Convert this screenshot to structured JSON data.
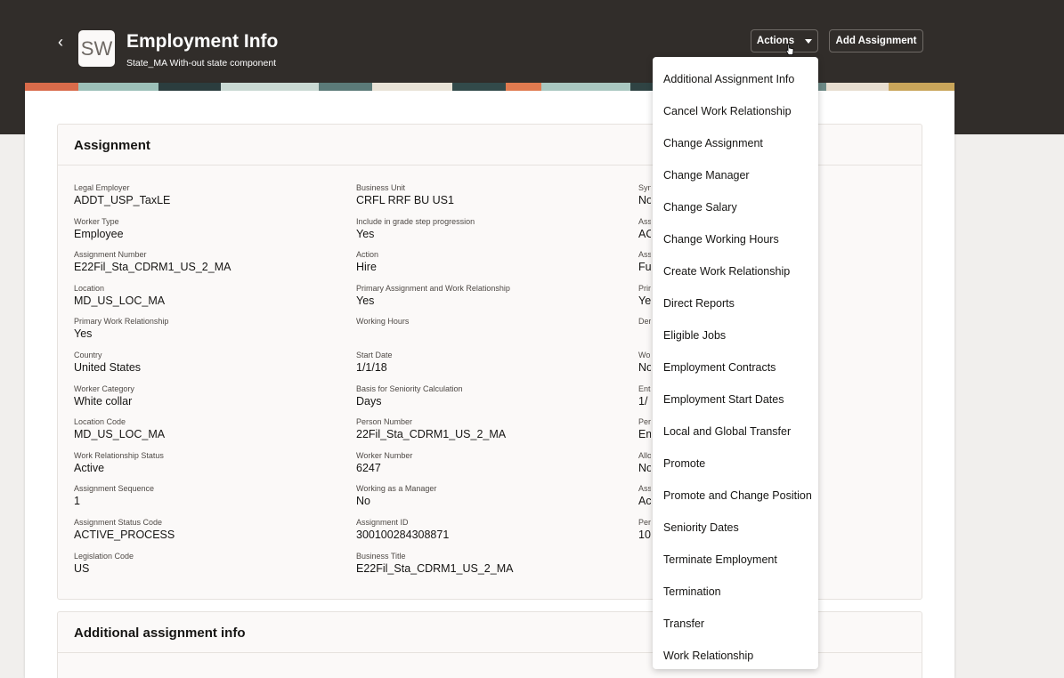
{
  "header": {
    "back_glyph": "‹",
    "avatar_initials": "SW",
    "title": "Employment Info",
    "subtitle": "State_MA With-out state component",
    "actions_label": "Actions",
    "add_assignment_label": "Add Assignment"
  },
  "colors": {
    "header_bg": "#312d2a",
    "page_bg": "#f1efed",
    "card_bg": "#fbf9f8",
    "text": "#161513",
    "label_text": "#4f4a46"
  },
  "assignment": {
    "title": "Assignment",
    "col1": [
      {
        "label": "Legal Employer",
        "value": "ADDT_USP_TaxLE"
      },
      {
        "label": "Worker Type",
        "value": "Employee"
      },
      {
        "label": "Assignment Number",
        "value": "E22Fil_Sta_CDRM1_US_2_MA"
      },
      {
        "label": "Location",
        "value": "MD_US_LOC_MA"
      },
      {
        "label": "Primary Work Relationship",
        "value": "Yes"
      },
      {
        "label": "Country",
        "value": "United States"
      },
      {
        "label": "Worker Category",
        "value": "White collar"
      },
      {
        "label": "Location Code",
        "value": "MD_US_LOC_MA"
      },
      {
        "label": "Work Relationship Status",
        "value": "Active"
      },
      {
        "label": "Assignment Sequence",
        "value": "1"
      },
      {
        "label": "Assignment Status Code",
        "value": "ACTIVE_PROCESS"
      },
      {
        "label": "Legislation Code",
        "value": "US"
      }
    ],
    "col2": [
      {
        "label": "Business Unit",
        "value": "CRFL RRF BU US1"
      },
      {
        "label": "Include in grade step progression",
        "value": "Yes"
      },
      {
        "label": "Action",
        "value": "Hire"
      },
      {
        "label": "Primary Assignment and Work Relationship",
        "value": "Yes"
      },
      {
        "label": "Working Hours",
        "value": ""
      },
      {
        "label": "Start Date",
        "value": "1/1/18"
      },
      {
        "label": "Basis for Seniority Calculation",
        "value": "Days"
      },
      {
        "label": "Person Number",
        "value": "22Fil_Sta_CDRM1_US_2_MA"
      },
      {
        "label": "Worker Number",
        "value": "6247"
      },
      {
        "label": "Working as a Manager",
        "value": "No"
      },
      {
        "label": "Assignment ID",
        "value": "300100284308871"
      },
      {
        "label": "Business Title",
        "value": "E22Fil_Sta_CDRM1_US_2_MA"
      }
    ],
    "col3": [
      {
        "label": "Syn",
        "value": "No"
      },
      {
        "label": "Ass",
        "value": "AC"
      },
      {
        "label": "Ass",
        "value": "Fu"
      },
      {
        "label": "Prir",
        "value": "Yes"
      },
      {
        "label": "Der",
        "value": ""
      },
      {
        "label": "Wo",
        "value": "No"
      },
      {
        "label": "Ent",
        "value": "1/"
      },
      {
        "label": "Per",
        "value": "Em"
      },
      {
        "label": "Allo",
        "value": "No"
      },
      {
        "label": "Ass",
        "value": "Ac"
      },
      {
        "label": "Per",
        "value": "10"
      }
    ]
  },
  "additional": {
    "title": "Additional assignment info"
  },
  "actions_menu": {
    "items": [
      "Additional Assignment Info",
      "Cancel Work Relationship",
      "Change Assignment",
      "Change Manager",
      "Change Salary",
      "Change Working Hours",
      "Create Work Relationship",
      "Direct Reports",
      "Eligible Jobs",
      "Employment Contracts",
      "Employment Start Dates",
      "Local and Global Transfer",
      "Promote",
      "Promote and Change Position",
      "Seniority Dates",
      "Terminate Employment",
      "Termination",
      "Transfer",
      "Work Relationship"
    ]
  }
}
